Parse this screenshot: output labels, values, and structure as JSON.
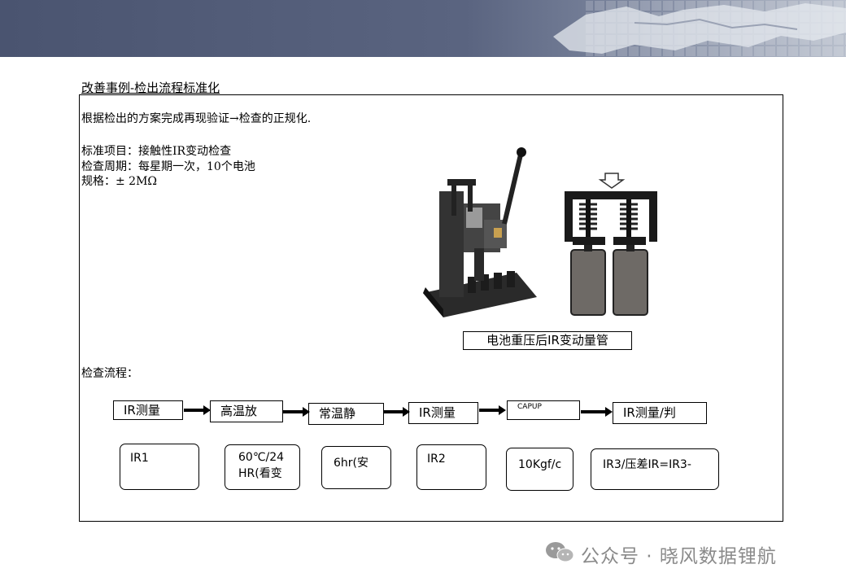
{
  "slide": {
    "title": "改善事例-检出流程标准化",
    "intro": "根据检出的方案完成再现验证→检查的正规化.",
    "standard_item": "标准项目：接触性IR变动检查",
    "check_period": "检查周期：每星期一次，10个电池",
    "spec": "规格：± 2MΩ",
    "image_caption": "电池重压后IR变动量管",
    "flow_label": "检查流程："
  },
  "flow_steps": [
    {
      "label": "IR测量"
    },
    {
      "label": "高温放"
    },
    {
      "label": "常温静"
    },
    {
      "label": "IR测量"
    },
    {
      "label": "CAPUP"
    },
    {
      "label": "IR测量/判"
    }
  ],
  "conditions": [
    {
      "text": "IR1"
    },
    {
      "text": "60℃/24\nHR(看变"
    },
    {
      "text": "6hr(安"
    },
    {
      "text": "IR2"
    },
    {
      "text": "10Kgf/c"
    },
    {
      "text": "IR3/压差IR=IR3-"
    }
  ],
  "watermark": {
    "text": "公众号 · 晓风数据锂航"
  },
  "colors": {
    "banner": "#4a5470",
    "accent_gray": "#8a8a8a"
  }
}
